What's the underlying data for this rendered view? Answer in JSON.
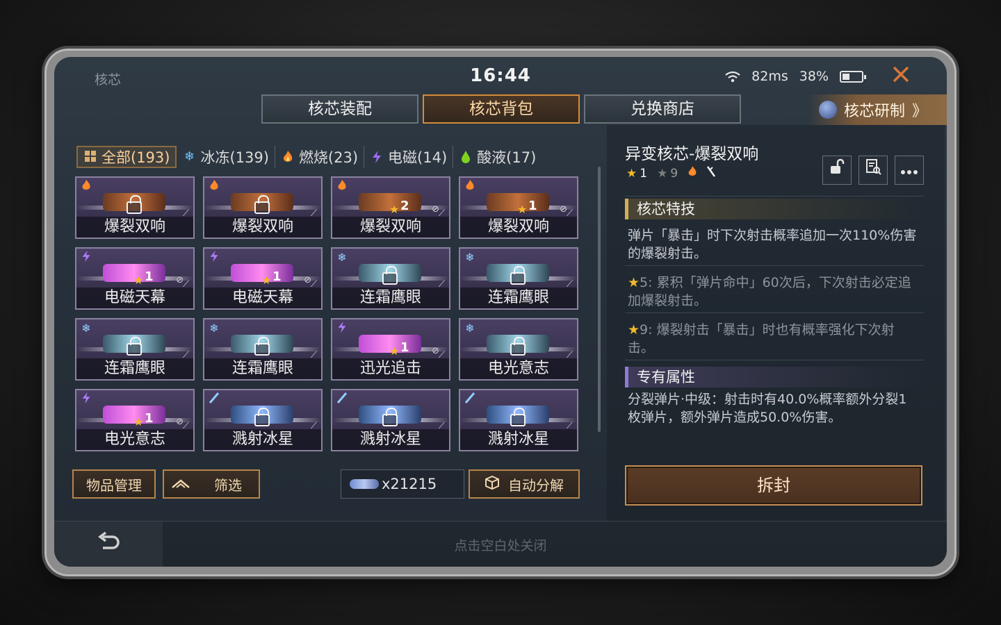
{
  "header": {
    "app_title": "核芯",
    "clock": "16:44",
    "ping": "82ms",
    "battery": "38%",
    "battery_level": 0.38
  },
  "tabs": [
    {
      "label": "核芯装配"
    },
    {
      "label": "核芯背包"
    },
    {
      "label": "兑换商店"
    }
  ],
  "research_label": "核芯研制",
  "research_chevron": "》",
  "filters": [
    {
      "label": "全部(193)",
      "icon": "grid-icon"
    },
    {
      "label": "冰冻(139)",
      "icon": "snowflake-icon"
    },
    {
      "label": "燃烧(23)",
      "icon": "flame-icon"
    },
    {
      "label": "电磁(14)",
      "icon": "lightning-icon"
    },
    {
      "label": "酸液(17)",
      "icon": "acid-drop-icon"
    }
  ],
  "items": [
    {
      "name": "爆裂双响",
      "type": "fire",
      "level": ""
    },
    {
      "name": "爆裂双响",
      "type": "fire",
      "level": ""
    },
    {
      "name": "爆裂双响",
      "type": "fire",
      "level": "2"
    },
    {
      "name": "爆裂双响",
      "type": "fire",
      "level": "1"
    },
    {
      "name": "电磁天幕",
      "type": "elec",
      "level": "1"
    },
    {
      "name": "电磁天幕",
      "type": "elec",
      "level": "1"
    },
    {
      "name": "连霜鹰眼",
      "type": "ice",
      "level": ""
    },
    {
      "name": "连霜鹰眼",
      "type": "ice",
      "level": ""
    },
    {
      "name": "连霜鹰眼",
      "type": "ice",
      "level": ""
    },
    {
      "name": "连霜鹰眼",
      "type": "ice",
      "level": ""
    },
    {
      "name": "迅光追击",
      "type": "elec",
      "level": "1"
    },
    {
      "name": "电光意志",
      "type": "ice",
      "level": ""
    },
    {
      "name": "电光意志",
      "type": "elec",
      "level": "1"
    },
    {
      "name": "溅射冰星",
      "type": "ice2",
      "level": ""
    },
    {
      "name": "溅射冰星",
      "type": "ice2",
      "level": ""
    },
    {
      "name": "溅射冰星",
      "type": "ice2",
      "level": ""
    }
  ],
  "bottom": {
    "manage_label": "物品管理",
    "filter_label": "筛选",
    "currency_amount": "x21215",
    "auto_label": "自动分解"
  },
  "detail": {
    "title": "异变核芯-爆裂双响",
    "star_level": "1",
    "star_max": "9",
    "skill_header": "核芯特技",
    "skill_text": "弹片「暴击」时下次射击概率追加一次110%伤害的爆裂射击。",
    "star5_text": "5: 累积「弹片命中」60次后，下次射击必定追加爆裂射击。",
    "star9_text": "9: 爆裂射击「暴击」时也有概率强化下次射击。",
    "attr_header": "专有属性",
    "attr_text": "分裂弹片·中级：射击时有40.0%概率额外分裂1枚弹片，额外弹片造成50.0%伤害。",
    "unseal_label": "拆封"
  },
  "footer": {
    "hint": "点击空白处关闭"
  },
  "colors": {
    "accent": "#d58b3a",
    "star": "#f2b92a",
    "rarity_purple": "#8b82a0"
  }
}
